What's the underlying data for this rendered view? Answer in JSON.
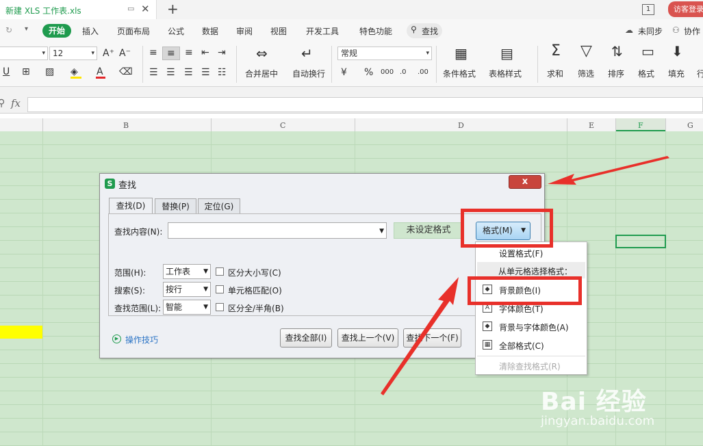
{
  "titlebar": {
    "file_name": "新建 XLS 工作表.xls",
    "window_count": "1",
    "login_label": "访客登录",
    "pin_icon": "pin-window-icon",
    "close_icon": "close-icon",
    "add_icon": "plus-icon"
  },
  "menu": {
    "items": [
      "开始",
      "插入",
      "页面布局",
      "公式",
      "数据",
      "审阅",
      "视图",
      "开发工具",
      "特色功能"
    ],
    "search_label": "查找",
    "sync_label": "未同步",
    "collab_label": "协作"
  },
  "ribbon": {
    "font_size": "12",
    "number_format": "常规",
    "merge_label": "合并居中",
    "wrap_label": "自动换行",
    "cond_format_label": "条件格式",
    "table_style_label": "表格样式",
    "sum_label": "求和",
    "filter_label": "筛选",
    "sort_label": "排序",
    "format_label": "格式",
    "fill_label": "填充",
    "row_label": "行"
  },
  "formula_bar": {
    "fx_label": "fx",
    "value": ""
  },
  "columns": [
    "B",
    "C",
    "D",
    "E",
    "F",
    "G"
  ],
  "dialog": {
    "title": "查找",
    "close_label": "x",
    "tabs": [
      "查找(D)",
      "替换(P)",
      "定位(G)"
    ],
    "find_label": "查找内容(N):",
    "find_value": "",
    "no_format_label": "未设定格式",
    "format_button": "格式(M)",
    "scope_label": "范围(H):",
    "scope_value": "工作表",
    "search_label": "搜索(S):",
    "search_value": "按行",
    "lookin_label": "查找范围(L):",
    "lookin_value": "智能",
    "case_label": "区分大小写(C)",
    "cell_match_label": "单元格匹配(O)",
    "width_label": "区分全/半角(B)",
    "tips_label": "操作技巧",
    "find_all": "查找全部(I)",
    "find_prev": "查找上一个(V)",
    "find_next": "查找下一个(F)"
  },
  "dropdown": {
    "items": [
      "设置格式(F)",
      "背景颜色(I)",
      "字体颜色(T)",
      "背景与字体颜色(A)",
      "全部格式(C)",
      "清除查找格式(R)"
    ],
    "section_label": "从单元格选择格式："
  },
  "watermark": {
    "brand": "Bai 经验",
    "url": "jingyan.baidu.com"
  },
  "colors": {
    "accent": "#1f9b4e",
    "grid_fill": "#cfe7cd",
    "highlight_yellow": "#ffff00",
    "annotation_red": "#e8302a"
  }
}
